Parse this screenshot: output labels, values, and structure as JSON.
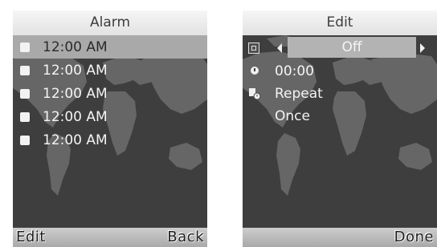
{
  "alarm_screen": {
    "title": "Alarm",
    "alarms": [
      {
        "time": "12:00 AM",
        "selected": true
      },
      {
        "time": "12:00 AM",
        "selected": false
      },
      {
        "time": "12:00 AM",
        "selected": false
      },
      {
        "time": "12:00 AM",
        "selected": false
      },
      {
        "time": "12:00 AM",
        "selected": false
      }
    ],
    "softkeys": {
      "left": "Edit",
      "right": "Back"
    }
  },
  "edit_screen": {
    "title": "Edit",
    "state_value": "Off",
    "time_value": "00:00",
    "repeat_label": "Repeat",
    "repeat_value": "Once",
    "softkeys": {
      "left": "",
      "right": "Done"
    }
  },
  "colors": {
    "title_bar": "#e9e9e9",
    "screen_bg": "#3e3e3e",
    "map_land": "#666666",
    "highlight": "#a9a9a9",
    "softkey_bar": "#bcbcbc"
  }
}
